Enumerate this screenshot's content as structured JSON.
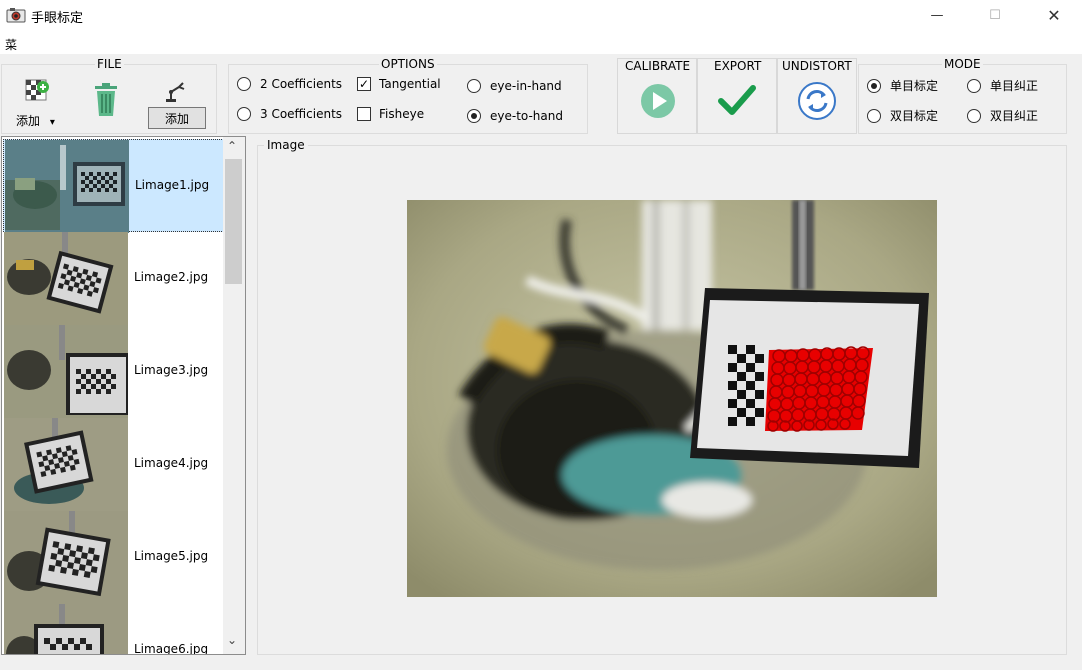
{
  "window": {
    "title": "手眼标定",
    "minimize_glyph": "—",
    "maximize_glyph": "☐",
    "close_glyph": "✕"
  },
  "menu": {
    "label": "菜单"
  },
  "file": {
    "title": "FILE",
    "add_label": "添加",
    "add_dropdown_glyph": "▾",
    "robot_add_label": "添加"
  },
  "options": {
    "title": "OPTIONS",
    "coeff2": "2 Coefficients",
    "coeff3": "3 Coefficients",
    "tangential": "Tangential",
    "tangential_checked": true,
    "fisheye": "Fisheye",
    "fisheye_checked": false,
    "eye_in_hand": "eye-in-hand",
    "eye_to_hand": "eye-to-hand",
    "selected_mode": "eye-to-hand"
  },
  "actions": {
    "calibrate": "CALIBRATE",
    "export": "EXPORT",
    "undistort": "UNDISTORT"
  },
  "mode": {
    "title": "MODE",
    "mono_calib": "单目标定",
    "mono_rectify": "单目纠正",
    "stereo_calib": "双目标定",
    "stereo_rectify": "双目纠正",
    "selected": "单目标定"
  },
  "images": {
    "items": [
      {
        "name": "Limage1.jpg",
        "selected": true
      },
      {
        "name": "Limage2.jpg",
        "selected": false
      },
      {
        "name": "Limage3.jpg",
        "selected": false
      },
      {
        "name": "Limage4.jpg",
        "selected": false
      },
      {
        "name": "Limage5.jpg",
        "selected": false
      },
      {
        "name": "Limage6.jpg",
        "selected": false
      }
    ],
    "scroll_up_glyph": "⌃",
    "scroll_down_glyph": "⌄"
  },
  "viewer": {
    "title": "Image"
  },
  "colors": {
    "calibrate_green": "#7cc8a6",
    "export_green": "#1a9c4c",
    "undistort_blue": "#3a78c8",
    "selection_blue": "#cce8ff",
    "corner_red": "#e00000"
  }
}
